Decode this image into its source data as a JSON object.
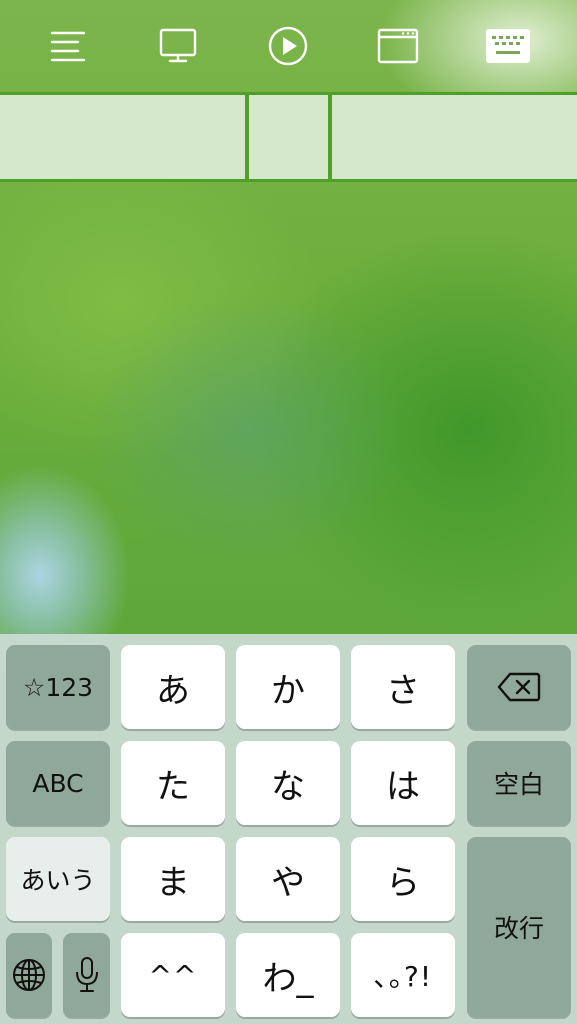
{
  "toolbar": {
    "icons": [
      {
        "name": "menu-lines-icon"
      },
      {
        "name": "monitor-icon"
      },
      {
        "name": "play-circle-icon"
      },
      {
        "name": "browser-window-icon"
      },
      {
        "name": "keyboard-icon"
      }
    ]
  },
  "keyboard": {
    "row1": {
      "numbers_label": "☆123",
      "key_a": "あ",
      "key_ka": "か",
      "key_sa": "さ"
    },
    "row2": {
      "abc_label": "ABC",
      "key_ta": "た",
      "key_na": "な",
      "key_ha": "は",
      "space_label": "空白"
    },
    "row3": {
      "kana_label": "あいう",
      "key_ma": "ま",
      "key_ya": "や",
      "key_ra": "ら",
      "return_label": "改行"
    },
    "row4": {
      "key_emoticon": "^^",
      "key_wa": "わ_",
      "key_punct": "､｡?!"
    }
  },
  "colors": {
    "toolbar_icon": "#ffffff",
    "key_white": "#ffffff",
    "key_function": "#8fa89a",
    "strip_border": "#4fa02a"
  }
}
